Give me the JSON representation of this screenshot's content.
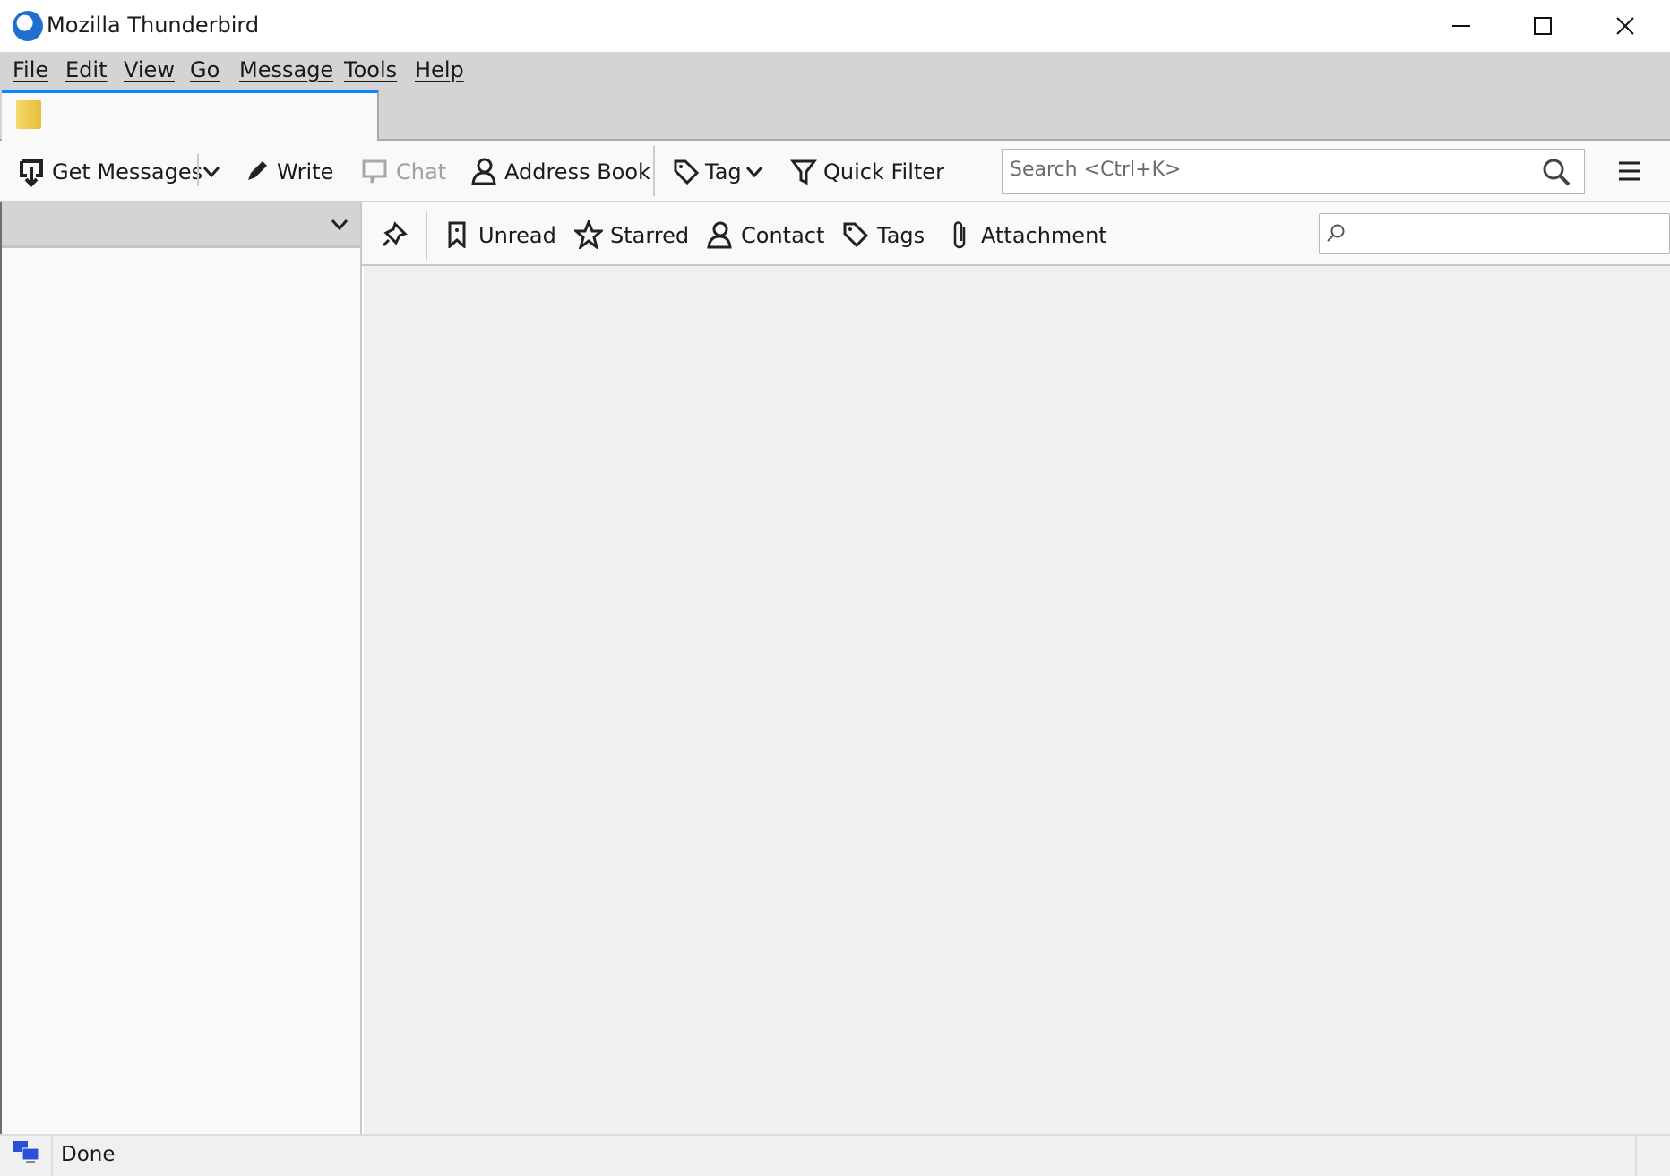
{
  "window": {
    "title": "Mozilla Thunderbird"
  },
  "menu": [
    "File",
    "Edit",
    "View",
    "Go",
    "Message",
    "Tools",
    "Help"
  ],
  "toolbar": {
    "get_messages": "Get Messages",
    "write": "Write",
    "chat": "Chat",
    "address_book": "Address Book",
    "tag": "Tag",
    "quick_filter": "Quick Filter",
    "search_placeholder": "Search <Ctrl+K>"
  },
  "quick_filter": {
    "unread": "Unread",
    "starred": "Starred",
    "contact": "Contact",
    "tags": "Tags",
    "attachment": "Attachment"
  },
  "status": {
    "text": "Done"
  },
  "colors": {
    "accent": "#0a84ff"
  }
}
